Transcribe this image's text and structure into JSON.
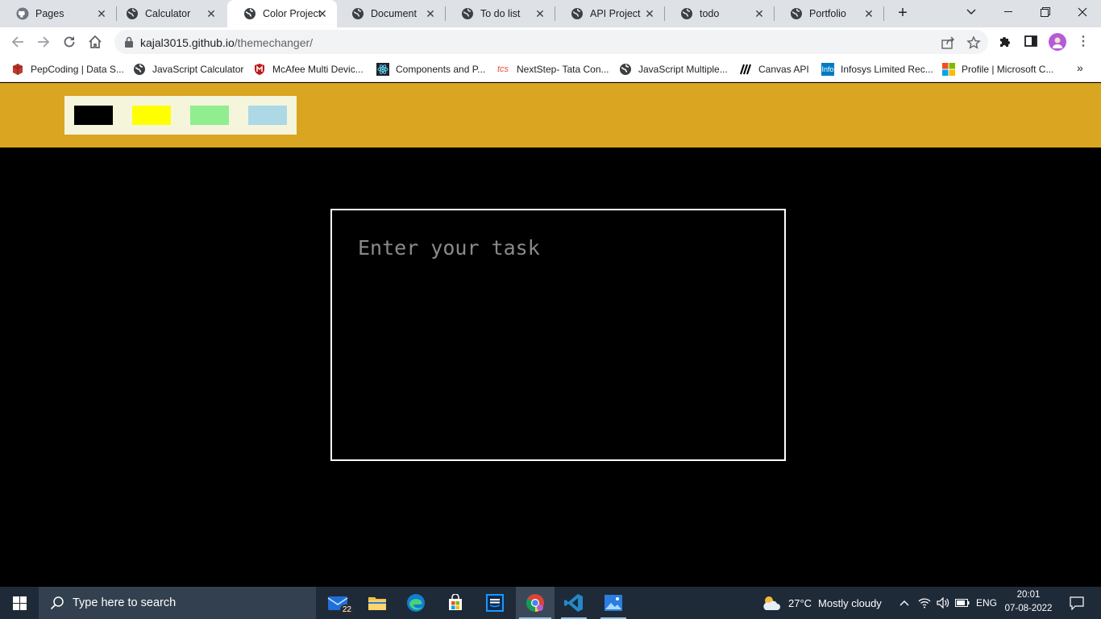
{
  "browser": {
    "tabs": [
      {
        "label": "Pages",
        "icon": "github-icon"
      },
      {
        "label": "Calculator",
        "icon": "globe-icon"
      },
      {
        "label": "Color Project",
        "icon": "globe-icon",
        "active": true
      },
      {
        "label": "Document",
        "icon": "globe-icon"
      },
      {
        "label": "To do list",
        "icon": "globe-icon"
      },
      {
        "label": "API Project",
        "icon": "globe-icon"
      },
      {
        "label": "todo",
        "icon": "globe-icon"
      },
      {
        "label": "Portfolio",
        "icon": "globe-icon"
      }
    ],
    "address": {
      "host": "kajal3015.github.io",
      "path": "/themechanger/"
    },
    "bookmarks": [
      {
        "label": "PepCoding | Data S...",
        "icon": "pepcoding-icon"
      },
      {
        "label": "JavaScript Calculator",
        "icon": "globe-icon"
      },
      {
        "label": "McAfee Multi Devic...",
        "icon": "mcafee-icon"
      },
      {
        "label": "Components and P...",
        "icon": "react-icon"
      },
      {
        "label": "NextStep- Tata Con...",
        "icon": "tcs-icon"
      },
      {
        "label": "JavaScript Multiple...",
        "icon": "globe-icon"
      },
      {
        "label": "Canvas API",
        "icon": "mdn-icon"
      },
      {
        "label": "Infosys Limited Rec...",
        "icon": "infosys-icon"
      },
      {
        "label": "Profile | Microsoft C...",
        "icon": "microsoft-icon"
      }
    ]
  },
  "page": {
    "header_color": "#daa520",
    "panel_color": "#f5f5dc",
    "swatches": [
      {
        "name": "black",
        "color": "#000000"
      },
      {
        "name": "yellow",
        "color": "#ffff00"
      },
      {
        "name": "lightgreen",
        "color": "#90ee90"
      },
      {
        "name": "lightblue",
        "color": "#add8e6"
      }
    ],
    "task_placeholder": "Enter your task",
    "task_value": ""
  },
  "taskbar": {
    "search_placeholder": "Type here to search",
    "mail_badge": "22",
    "weather": {
      "temp": "27°C",
      "condition": "Mostly cloudy"
    },
    "language": "ENG",
    "time": "20:01",
    "date": "07-08-2022"
  }
}
